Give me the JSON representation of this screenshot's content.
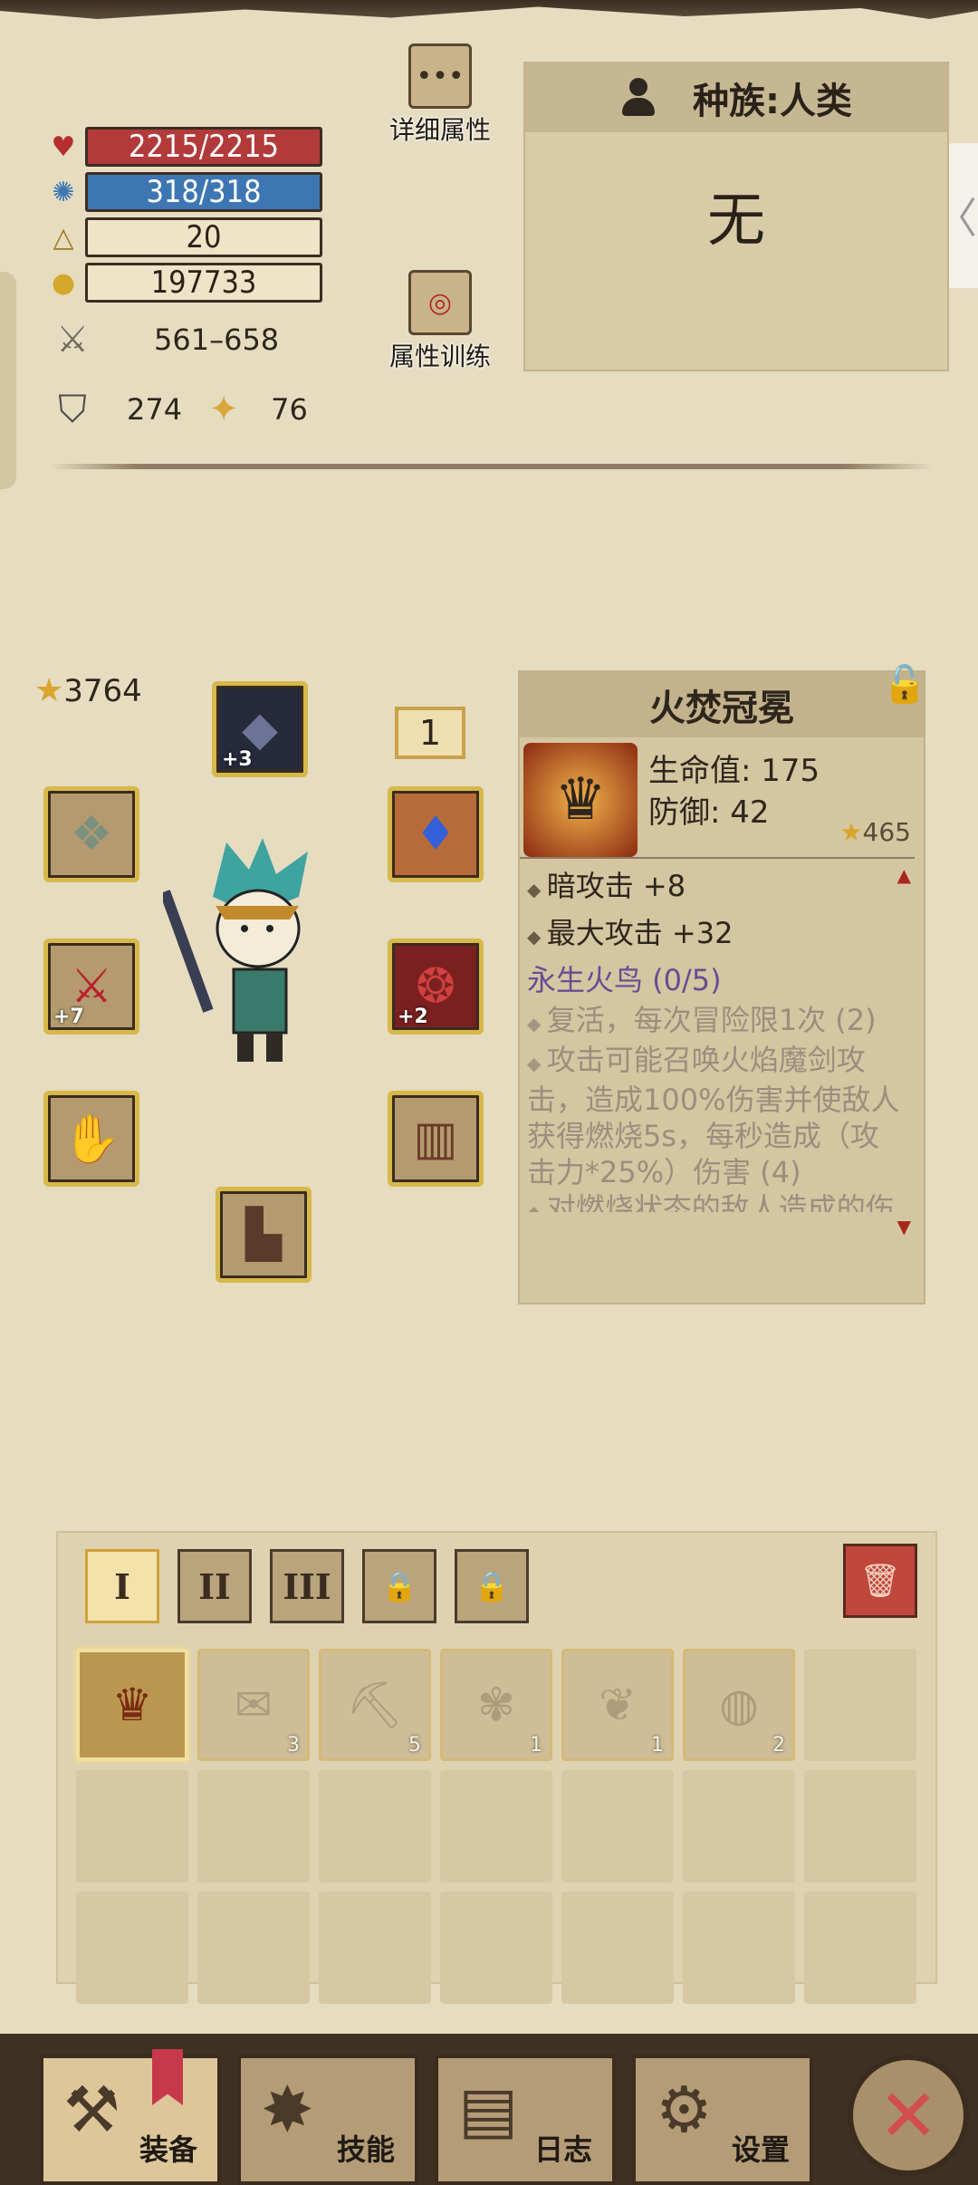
{
  "stats": {
    "hp": "2215/2215",
    "mp": "318/318",
    "level": "20",
    "gold": "197733",
    "attack": "561–658",
    "defense": "274",
    "luck": "76"
  },
  "buttons": {
    "detail_attrs": "详细属性",
    "attr_training": "属性训练",
    "right_tab_glyph": "〈"
  },
  "race": {
    "label": "种族:人类",
    "value": "无"
  },
  "equipment": {
    "score": "3764",
    "slot_box_number": "1",
    "helmet_plus": "+3",
    "weapon_plus": "+7",
    "armor_plus": "+2"
  },
  "item_detail": {
    "name": "火焚冠冕",
    "hp": "生命值: 175",
    "defense": "防御: 42",
    "score": "465",
    "bonus1": "暗攻击 +8",
    "bonus2": "最大攻击 +32",
    "set_name": "永生火鸟 (0/5)",
    "set1": "复活，每次冒险限1次 (2)",
    "set2": "攻击可能召唤火焰魔剑攻击，造成100%伤害并使敌人获得燃烧5s，每秒造成（攻击力*25%）伤害 (4)",
    "set3": "对燃烧状态的敌人造成的伤"
  },
  "inventory": {
    "tabs": [
      "I",
      "II",
      "III"
    ],
    "items": [
      {
        "icon": "crown",
        "count": ""
      },
      {
        "icon": "scroll",
        "count": "3"
      },
      {
        "icon": "pickaxe",
        "count": "5"
      },
      {
        "icon": "coral",
        "count": "1"
      },
      {
        "icon": "rope",
        "count": "1"
      },
      {
        "icon": "shell",
        "count": "2"
      }
    ]
  },
  "nav": {
    "equip": "装备",
    "skills": "技能",
    "log": "日志",
    "settings": "设置"
  },
  "colors": {
    "hp_bar": "#b23a3a",
    "mp_bar": "#3d76b3",
    "slot_border": "#d7b84a",
    "set_name": "#6b4b93",
    "close_x": "#d24e4e"
  }
}
